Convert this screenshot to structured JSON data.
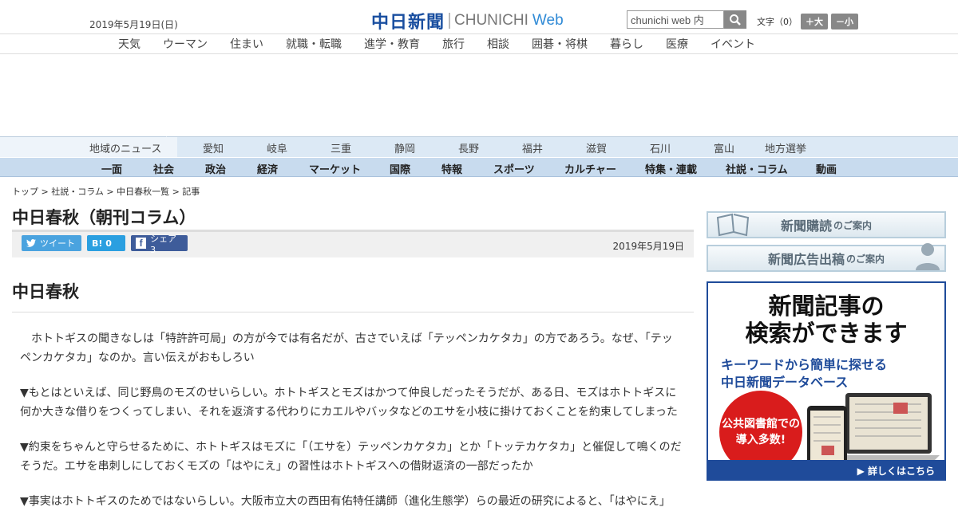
{
  "header": {
    "date": "2019年5月19日(日)",
    "logo_main": "中日新聞",
    "logo_sub": "CHUNICHI",
    "logo_web": "Web",
    "search_placeholder": "chunichi web 内",
    "font_label": "文字（0）",
    "font_up": "＋大",
    "font_down": "－小"
  },
  "subnav": [
    "天気",
    "ウーマン",
    "住まい",
    "就職・転職",
    "進学・教育",
    "旅行",
    "相談",
    "囲碁・将棋",
    "暮らし",
    "医療",
    "イベント"
  ],
  "regional": {
    "label": "地域のニュース",
    "items": [
      "愛知",
      "岐阜",
      "三重",
      "静岡",
      "長野",
      "福井",
      "滋賀",
      "石川",
      "富山",
      "地方選挙"
    ]
  },
  "mainnav": [
    "一面",
    "社会",
    "政治",
    "経済",
    "マーケット",
    "国際",
    "特報",
    "スポーツ",
    "カルチャー",
    "特集・連載",
    "社説・コラム",
    "動画"
  ],
  "breadcrumb": "トップ > 社説・コラム > 中日春秋一覧 > 記事",
  "article": {
    "title": "中日春秋（朝刊コラム）",
    "tweet": "ツイート",
    "hatena": "B! 0",
    "share": "シェア 3",
    "date": "2019年5月19日",
    "column_title": "中日春秋",
    "paragraphs": [
      "　ホトトギスの聞きなしは「特許許可局」の方が今では有名だが、古さでいえば「テッペンカケタカ」の方であろう。なぜ、「テッペンカケタカ」なのか。言い伝えがおもしろい",
      "▼もとはといえば、同じ野鳥のモズのせいらしい。ホトトギスとモズはかつて仲良しだったそうだが、ある日、モズはホトトギスに何か大きな借りをつくってしまい、それを返済する代わりにカエルやバッタなどのエサを小枝に掛けておくことを約束してしまった",
      "▼約束をちゃんと守らせるために、ホトトギスはモズに「（エサを）テッペンカケタカ」とか「トッテカケタカ」と催促して鳴くのだそうだ。エサを串刺しにしておくモズの「はやにえ」の習性はホトトギスへの借財返済の一部だったか",
      "▼事実はホトトギスのためではないらしい。大阪市立大の西田有佑特任講師（進化生態学）らの最近の研究によると、「はやにえ」"
    ]
  },
  "sidebar": {
    "subscribe": "新聞購読",
    "subscribe_small": "のご案内",
    "ad": "新聞広告出稿",
    "ad_small": "のご案内",
    "promo_h1a": "新聞記事の",
    "promo_h1b": "検索ができます",
    "promo_h2a": "キーワードから簡単に探せる",
    "promo_h2b": "中日新聞データベース",
    "promo_circle": "公共図書館での導入多数!",
    "promo_foot": "▶ 詳しくはこちら"
  },
  "colors": {
    "brand": "#1a4fa0",
    "nav": "#c8dbee",
    "twitter": "#4aa3df",
    "facebook": "#3e5c9a",
    "promo_red": "#d91c1c"
  }
}
